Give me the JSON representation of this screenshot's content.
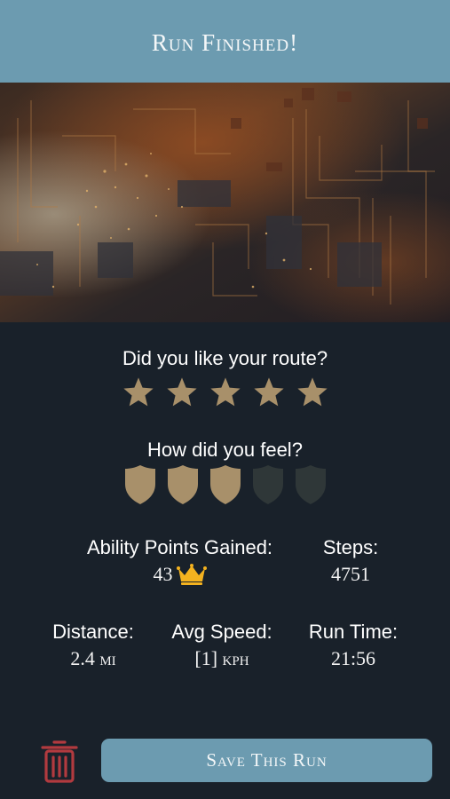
{
  "header": {
    "title": "Run Finished!"
  },
  "route_question": "Did you like your route?",
  "route_rating": {
    "value": 5,
    "max": 5
  },
  "feel_question": "How did you feel?",
  "feel_rating": {
    "value": 3,
    "max": 5
  },
  "stats": {
    "ability_points": {
      "label": "Ability Points Gained:",
      "value": "43",
      "icon": "crown-icon"
    },
    "steps": {
      "label": "Steps:",
      "value": "4751"
    },
    "distance": {
      "label": "Distance:",
      "value": "2.4 mi"
    },
    "avg_speed": {
      "label": "Avg Speed:",
      "value": "[1] kph"
    },
    "run_time": {
      "label": "Run Time:",
      "value": "21:56"
    }
  },
  "actions": {
    "delete_icon": "trash-icon",
    "save_label": "Save This Run"
  },
  "colors": {
    "accent": "#6c9bb0",
    "background": "#19212a",
    "rating_active": "#a8906a",
    "rating_inactive": "#2f3738",
    "crown": "#f4b21f",
    "delete": "#b13a3f"
  }
}
